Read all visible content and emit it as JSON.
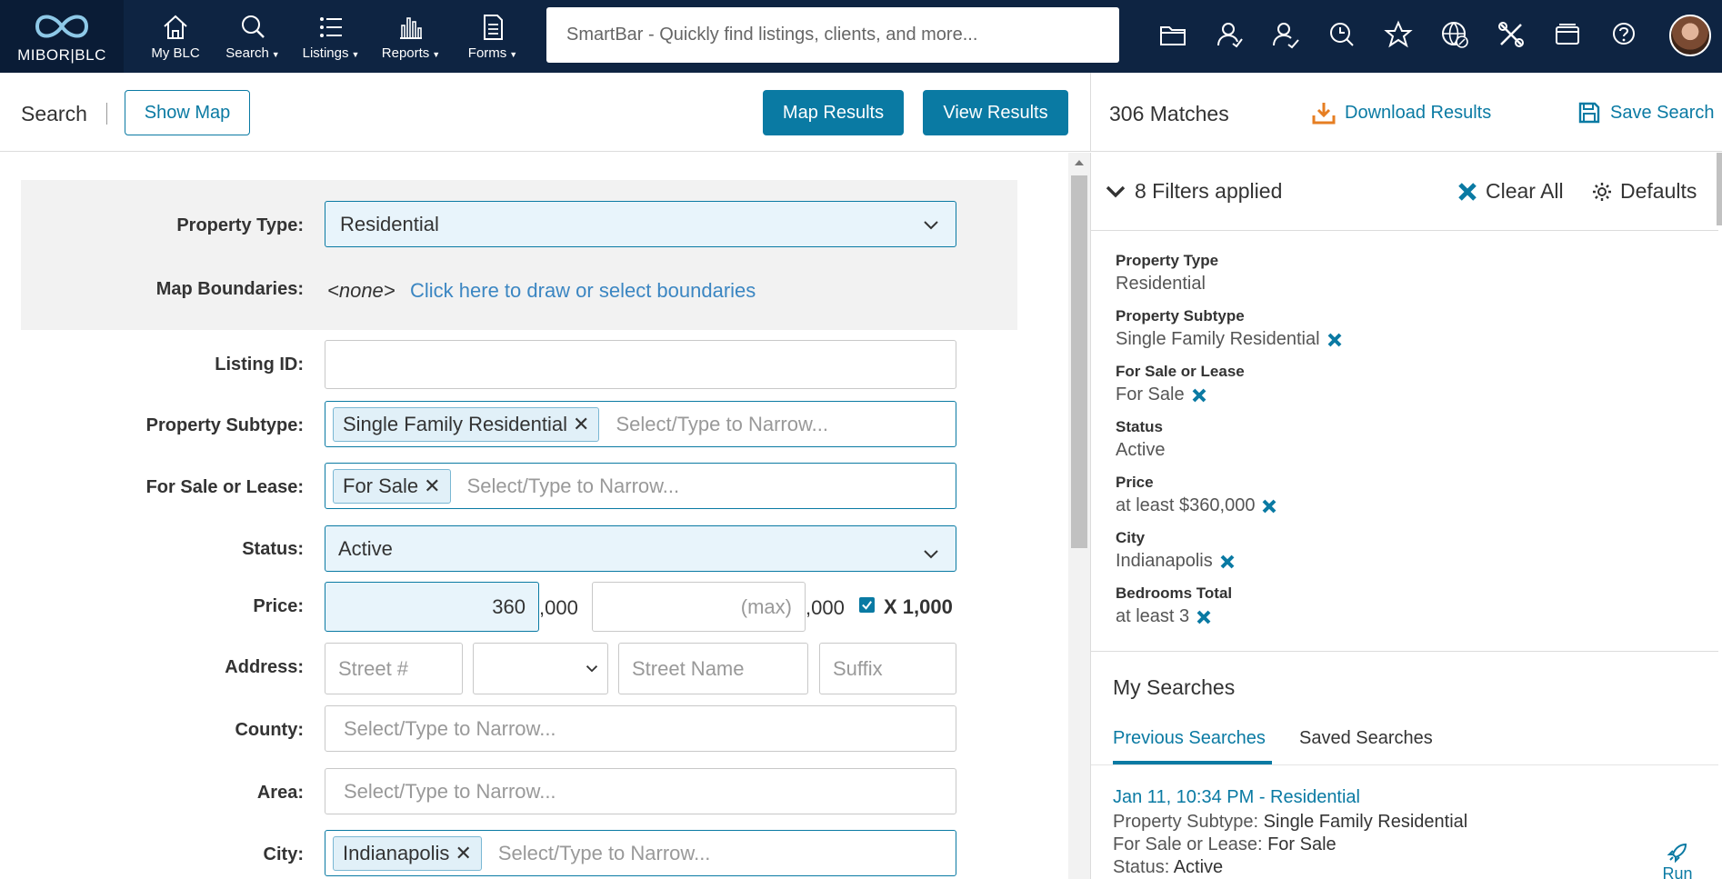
{
  "nav": {
    "logo_text": "MIBOR|BLC",
    "items": [
      {
        "label": "My BLC",
        "has_caret": false
      },
      {
        "label": "Search",
        "has_caret": true
      },
      {
        "label": "Listings",
        "has_caret": true
      },
      {
        "label": "Reports",
        "has_caret": true
      },
      {
        "label": "Forms",
        "has_caret": true
      }
    ],
    "smartbar_placeholder": "SmartBar - Quickly find listings, clients, and more...",
    "caret": "▼",
    "accent_color": "#0a7aa3",
    "nav_bg": "#0e2442"
  },
  "toolbar": {
    "search_label": "Search",
    "show_map": "Show Map",
    "map_results": "Map Results",
    "view_results": "View Results"
  },
  "results_bar": {
    "matches": "306 Matches",
    "download": "Download Results",
    "save_search": "Save Search"
  },
  "form": {
    "property_type": {
      "label": "Property Type:",
      "value": "Residential"
    },
    "map_boundaries": {
      "label": "Map Boundaries:",
      "none": "<none>",
      "link": "Click here to draw or select boundaries"
    },
    "listing_id": {
      "label": "Listing ID:",
      "value": ""
    },
    "property_subtype": {
      "label": "Property Subtype:",
      "tag": "Single Family Residential",
      "placeholder": "Select/Type to Narrow..."
    },
    "sale_lease": {
      "label": "For Sale or Lease:",
      "tag": "For Sale",
      "placeholder": "Select/Type to Narrow..."
    },
    "status": {
      "label": "Status:",
      "value": "Active"
    },
    "price": {
      "label": "Price:",
      "min": "360",
      "max_placeholder": "(max)",
      "suffix": ",000",
      "multiplier_label": "X 1,000",
      "multiplier_checked": true
    },
    "address": {
      "label": "Address:",
      "street_no_placeholder": "Street #",
      "direction": "",
      "street_name_placeholder": "Street Name",
      "suffix_placeholder": "Suffix"
    },
    "county": {
      "label": "County:",
      "placeholder": "Select/Type to Narrow..."
    },
    "area": {
      "label": "Area:",
      "placeholder": "Select/Type to Narrow..."
    },
    "city": {
      "label": "City:",
      "tag": "Indianapolis",
      "placeholder": "Select/Type to Narrow..."
    },
    "tag_remove": "✕"
  },
  "filters": {
    "summary": "8 Filters applied",
    "clear_all": "Clear All",
    "defaults": "Defaults",
    "items": [
      {
        "label": "Property Type",
        "value": "Residential",
        "removable": false
      },
      {
        "label": "Property Subtype",
        "value": "Single Family Residential",
        "removable": true
      },
      {
        "label": "For Sale or Lease",
        "value": "For Sale",
        "removable": true
      },
      {
        "label": "Status",
        "value": "Active",
        "removable": false
      },
      {
        "label": "Price",
        "value": "at least $360,000",
        "removable": true
      },
      {
        "label": "City",
        "value": "Indianapolis",
        "removable": true
      },
      {
        "label": "Bedrooms Total",
        "value": "at least 3",
        "removable": true
      }
    ]
  },
  "my_searches": {
    "title": "My Searches",
    "tabs": [
      "Previous Searches",
      "Saved Searches"
    ],
    "active_tab": "Previous Searches",
    "entry": {
      "title": "Jan 11, 10:34 PM - Residential",
      "lines": [
        {
          "key": "Property Subtype:",
          "value": "Single Family Residential"
        },
        {
          "key": "For Sale or Lease:",
          "value": "For Sale"
        },
        {
          "key": "Status:",
          "value": "Active"
        }
      ],
      "run_label": "Run"
    }
  }
}
